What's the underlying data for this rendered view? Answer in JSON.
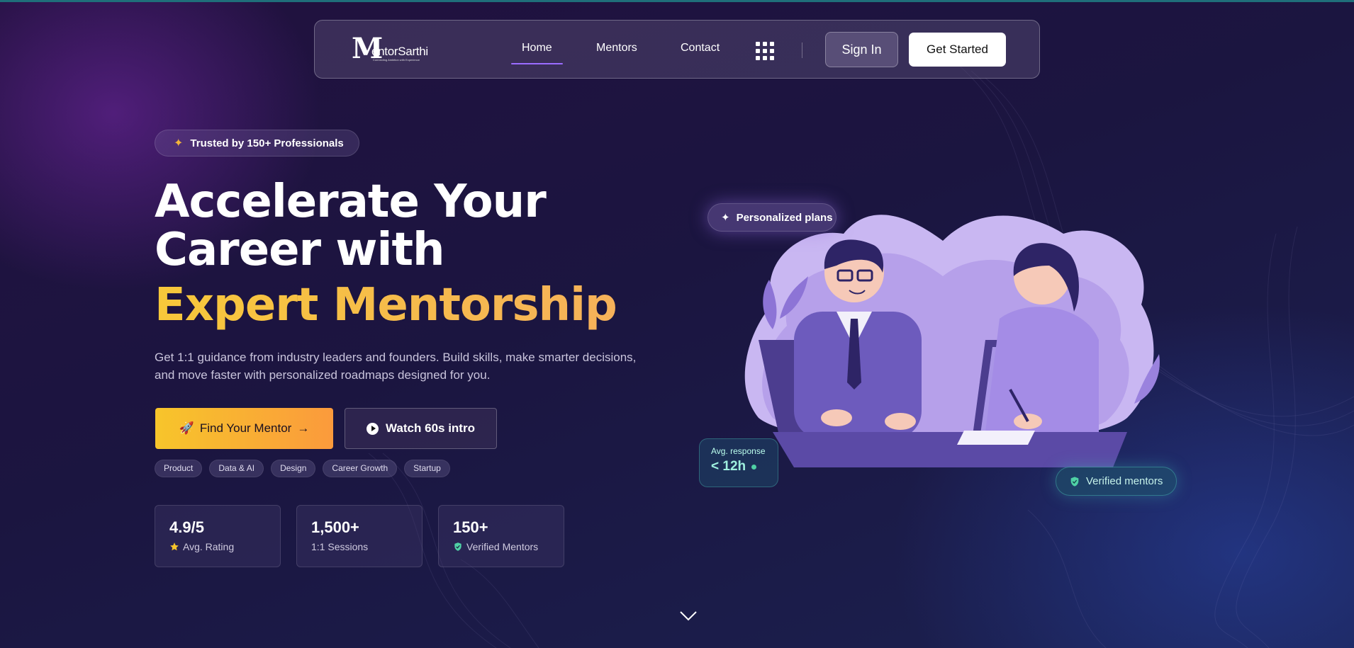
{
  "colors": {
    "accent_gold": "#f7c52b",
    "accent_orange": "#fb9a3c",
    "accent_purple": "#9b6cff",
    "teal": "#4fd1a5"
  },
  "nav": {
    "logo_letter": "M",
    "logo_text": "entorSarthi",
    "logo_tagline": "Connecting Ambition with Experience",
    "links": [
      "Home",
      "Mentors",
      "Contact"
    ],
    "active": "Home",
    "apps_icon": "grid-icon",
    "signin": "Sign In",
    "get_started": "Get Started"
  },
  "hero": {
    "badge": "Trusted by 150+ Professionals",
    "title_line1": "Accelerate Your",
    "title_line2": "Career with",
    "title_highlight": "Expert Mentorship",
    "subtitle": "Get 1:1 guidance from industry leaders and founders. Build skills, make smarter decisions, and move faster with personalized roadmaps designed for you.",
    "cta_primary": "Find Your Mentor",
    "cta_primary_arrow": "→",
    "cta_secondary": "Watch 60s intro",
    "tags": [
      "Product",
      "Data & AI",
      "Design",
      "Career Growth",
      "Startup"
    ],
    "stats": [
      {
        "value": "4.9/5",
        "label": "Avg. Rating",
        "icon": "star-icon"
      },
      {
        "value": "1,500+",
        "label": "1:1 Sessions",
        "icon": ""
      },
      {
        "value": "150+",
        "label": "Verified Mentors",
        "icon": "shield-check-icon"
      }
    ]
  },
  "illustration": {
    "plans_pill": "Personalized plans",
    "response_label": "Avg. response",
    "response_value": "< 12h",
    "verified_pill": "Verified mentors"
  }
}
